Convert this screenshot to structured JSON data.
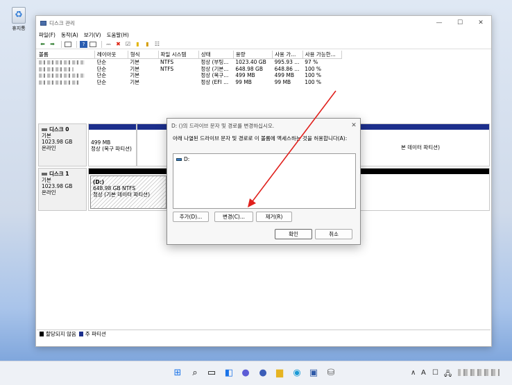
{
  "desktop": {
    "recycle_label": "휴지통"
  },
  "window": {
    "title": "디스크 관리",
    "menu": [
      "파일(F)",
      "동작(A)",
      "보기(V)",
      "도움말(H)"
    ],
    "columns": [
      "볼륨",
      "레이아웃",
      "형식",
      "파일 시스템",
      "상태",
      "용량",
      "사용 가...",
      "사용 가능한..."
    ],
    "rows": [
      [
        "",
        "단순",
        "기본",
        "NTFS",
        "정상 (부팅...",
        "1023.40 GB",
        "995.93 ...",
        "97 %"
      ],
      [
        "",
        "단순",
        "기본",
        "NTFS",
        "정상 (기본...",
        "648.98 GB",
        "648.86 ...",
        "100 %"
      ],
      [
        "",
        "단순",
        "기본",
        "",
        "정상 (복구...",
        "499 MB",
        "499 MB",
        "100 %"
      ],
      [
        "",
        "단순",
        "기본",
        "",
        "정상 (EFI ...",
        "99 MB",
        "99 MB",
        "100 %"
      ]
    ],
    "disk0": {
      "name": "디스크 0",
      "type": "기본",
      "size": "1023.98 GB",
      "status": "온라인",
      "p1_size": "499 MB",
      "p1_status": "정상 (복구 파티션)",
      "p2_tail": "본 데이터 파티션)"
    },
    "disk1": {
      "name": "디스크 1",
      "type": "기본",
      "size": "1023.98 GB",
      "status": "온라인",
      "p1_name": "(D:)",
      "p1_size": "648.98 GB NTFS",
      "p1_status": "정상 (기본 데이터 파티션)"
    },
    "legend": {
      "unallocated": "할당되지 않음",
      "primary": "주 파티션"
    }
  },
  "dialog": {
    "title": "D: ()의 드라이브 문자 및 경로를 변경하십시오.",
    "description": "아래 나열된 드라이브 문자 및 경로로 이 볼륨에 액세스하는 것을 허용합니다(A):",
    "list_item": "D:",
    "add": "추가(D)...",
    "change": "변경(C)...",
    "remove": "제거(R)",
    "ok": "확인",
    "cancel": "취소"
  },
  "taskbar": {
    "lang": "A"
  },
  "colors": {
    "primary_partition": "#1c2f8c",
    "unallocated": "#000000",
    "arrow": "#e0201c"
  }
}
